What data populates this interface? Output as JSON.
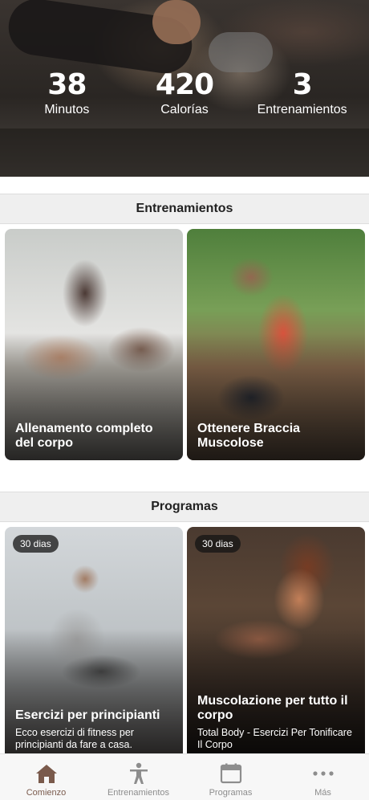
{
  "stats": [
    {
      "value": "38",
      "label": "Minutos"
    },
    {
      "value": "420",
      "label": "Calorías"
    },
    {
      "value": "3",
      "label": "Entrenamientos"
    }
  ],
  "sections": {
    "workouts_title": "Entrenamientos",
    "programs_title": "Programas"
  },
  "workouts": [
    {
      "title": "Allenamento completo del corpo"
    },
    {
      "title": "Ottenere Braccia Muscolose"
    }
  ],
  "programs": [
    {
      "badge": "30 dias",
      "title": "Esercizi per principianti",
      "subtitle": "Ecco esercizi di fitness per principianti da fare a casa."
    },
    {
      "badge": "30 dias",
      "title": "Muscolazione per tutto il corpo",
      "subtitle": "Total Body - Esercizi Per Tonificare Il Corpo"
    }
  ],
  "nav": {
    "active_color": "#7a5a4c",
    "inactive_color": "#8d8d8d",
    "items": [
      {
        "label": "Comienzo",
        "icon": "home-icon",
        "active": true
      },
      {
        "label": "Entrenamientos",
        "icon": "person-icon",
        "active": false
      },
      {
        "label": "Programas",
        "icon": "calendar-icon",
        "active": false
      },
      {
        "label": "Más",
        "icon": "more-icon",
        "active": false
      }
    ]
  }
}
